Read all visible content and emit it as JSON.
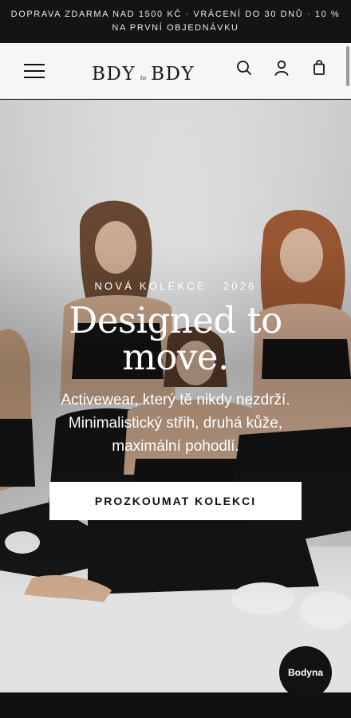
{
  "announcement": {
    "line1": "DOPRAVA ZDARMA NAD 1500 KČ  ·  VRÁCENÍ DO 30 DNŮ  ·  10 %",
    "line2": "NA PRVNÍ OBJEDNÁVKU"
  },
  "header": {
    "logo_left": "BDY",
    "logo_mid": "to",
    "logo_right": "BDY",
    "icons": [
      "menu-icon",
      "search-icon",
      "account-icon",
      "bag-icon"
    ]
  },
  "hero": {
    "eyebrow": "NOVÁ KOLEKCE · 2026",
    "headline_line1": "Designed to",
    "headline_line2": "move.",
    "subline_line1": "Activewear, který tě nikdy nezdrží.",
    "subline_line2": "Minimalistický střih, druhá kůže,",
    "subline_line3": "maximální pohodlí.",
    "cta_label": "PROZKOUMAT KOLEKCI"
  },
  "chat": {
    "label": "Bodyna"
  },
  "colors": {
    "announcement_bg": "#141414",
    "header_bg": "#f6f6f4",
    "cta_bg": "#ffffff",
    "chat_bg": "#121212"
  }
}
